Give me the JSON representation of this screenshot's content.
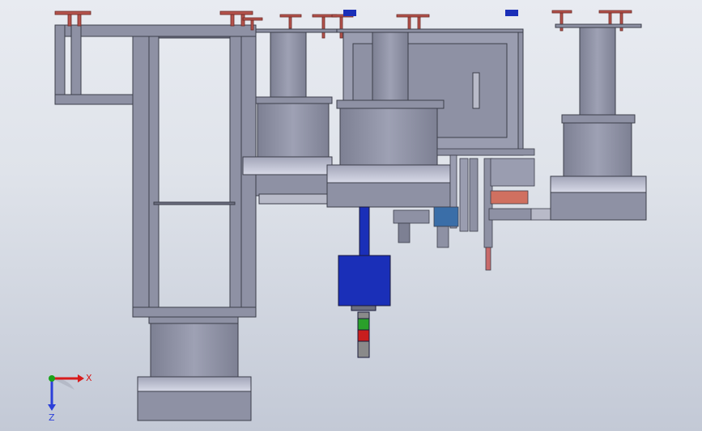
{
  "viewport": {
    "background_top": "#e8ebf1",
    "background_bottom": "#c3c9d6"
  },
  "model": {
    "metal_color": "#8e91a4",
    "metal_dark": "#6c6f80",
    "drum_light": "#d4d6e6",
    "motor_color": "#1a2fb8",
    "clamp_color": "#b5534c",
    "signal_colors": [
      "#2aa02a",
      "#c81e1e",
      "#8a8a8a"
    ]
  },
  "triad": {
    "x_label": "X",
    "y_label": "Y",
    "z_label": "Z",
    "x_color": "#d81b1b",
    "y_color": "#1aa31a",
    "z_color": "#2b3fd9"
  }
}
